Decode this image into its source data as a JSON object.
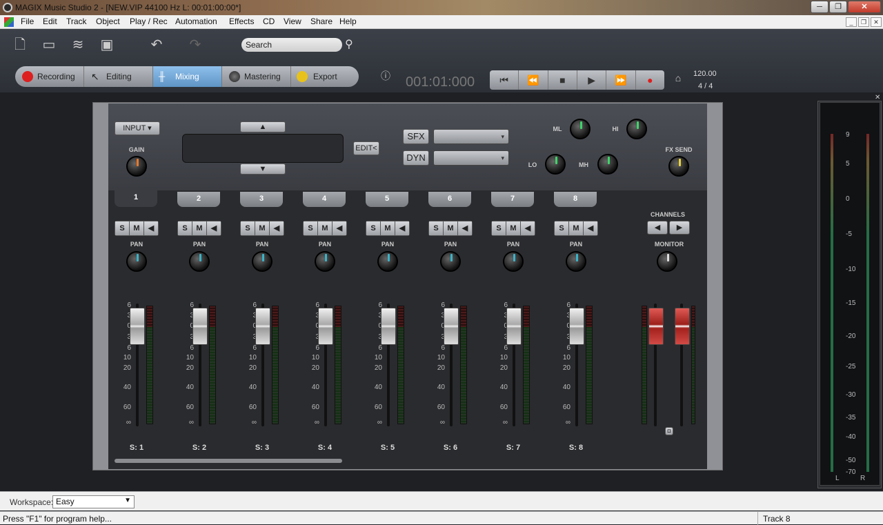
{
  "window": {
    "title": "MAGIX Music Studio 2 - [NEW.VIP   44100 Hz L: 00:01:00:00*]"
  },
  "menu": [
    "File",
    "Edit",
    "Track",
    "Object",
    "Play / Rec",
    "Automation",
    "Effects",
    "CD",
    "View",
    "Share",
    "Help"
  ],
  "toolbar": {
    "search_placeholder": "Search"
  },
  "modes": [
    "Recording",
    "Editing",
    "Mixing",
    "Mastering",
    "Export"
  ],
  "active_mode": "Mixing",
  "transport": {
    "timecode": "001:01:000",
    "tempo": "120.00",
    "signature": "4 / 4"
  },
  "mixer": {
    "input_label": "INPUT",
    "gain_label": "GAIN",
    "edit_label": "EDIT<",
    "sfx_label": "SFX",
    "dyn_label": "DYN",
    "eq_labels": {
      "ml": "ML",
      "hi": "HI",
      "lo": "LO",
      "mh": "MH"
    },
    "fx_send_label": "FX SEND",
    "channels_label": "CHANNELS",
    "monitor_label": "MONITOR",
    "pan_label": "PAN",
    "s_label": "S",
    "m_label": "M",
    "channels": [
      {
        "num": "1",
        "name": "S:  1"
      },
      {
        "num": "2",
        "name": "S:  2"
      },
      {
        "num": "3",
        "name": "S:  3"
      },
      {
        "num": "4",
        "name": "S:  4"
      },
      {
        "num": "5",
        "name": "S:  5"
      },
      {
        "num": "6",
        "name": "S:  6"
      },
      {
        "num": "7",
        "name": "S:  7"
      },
      {
        "num": "8",
        "name": "S:  8"
      }
    ],
    "fader_scale": [
      "6",
      "3",
      "0",
      "3",
      "6",
      "10",
      "20",
      "40",
      "60",
      "∞"
    ]
  },
  "master_meter": {
    "ticks": [
      "9",
      "5",
      "0",
      "-5",
      "-10",
      "-15",
      "-20",
      "-25",
      "-30",
      "-35",
      "-40",
      "-50",
      "-70"
    ],
    "left": "L",
    "right": "R"
  },
  "workspace": {
    "label": "Workspace:",
    "value": "Easy"
  },
  "status": {
    "help": "Press \"F1\" for program help...",
    "track": "Track 8"
  },
  "colors": {
    "record": "#dd1f1f",
    "active_mode": "#6ea6d6",
    "pan_knob": "#3bb3c8",
    "eq_knob": "#3fd46a",
    "fx_knob": "#e8d23a",
    "gain_knob": "#e8792a"
  }
}
